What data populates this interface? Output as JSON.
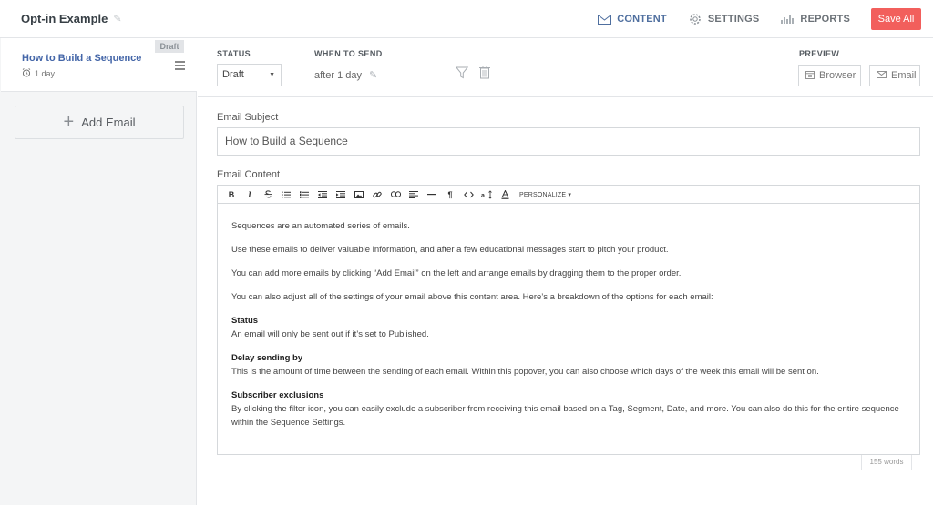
{
  "header": {
    "sequence_title": "Opt-in Example",
    "nav": {
      "content": "CONTENT",
      "settings": "SETTINGS",
      "reports": "REPORTS"
    },
    "save_label": "Save All"
  },
  "sidebar": {
    "email": {
      "name": "How to Build a Sequence",
      "delay": "1 day",
      "badge": "Draft"
    },
    "add_email_label": "Add Email"
  },
  "controls": {
    "status_label": "STATUS",
    "status_value": "Draft",
    "when_label": "WHEN TO SEND",
    "when_value": "after 1 day",
    "preview_label": "PREVIEW",
    "browser_label": "Browser",
    "email_label": "Email"
  },
  "editor": {
    "subject_label": "Email Subject",
    "subject_value": "How to Build a Sequence",
    "content_label": "Email Content",
    "toolbar": {
      "bold": "B",
      "italic": "I",
      "personalize": "PERSONALIZE ▾"
    },
    "paragraphs": [
      "Sequences are an automated series of emails.",
      "Use these emails to deliver valuable information, and after a few educational messages start to pitch your product.",
      "You can add more emails by clicking “Add Email” on the left and arrange emails by dragging them to the proper order.",
      "You can also adjust all of the settings of your email above this content area. Here’s a breakdown of the options for each email:"
    ],
    "sections": [
      {
        "heading": "Status",
        "body": "An email will only be sent out if it’s set to Published."
      },
      {
        "heading": "Delay sending by",
        "body": "This is the amount of time between the sending of each email. Within this popover, you can also choose which days of the week this email will be sent on."
      },
      {
        "heading": "Subscriber exclusions",
        "body": "By clicking the filter icon, you can easily exclude a subscriber from receiving this email based on a Tag, Segment, Date, and more. You can also do this for the entire sequence within the Sequence Settings."
      }
    ],
    "word_count": "155 words"
  },
  "colors": {
    "accent": "#4f6f9f",
    "save": "#f25f5c",
    "link": "#4466a8"
  }
}
